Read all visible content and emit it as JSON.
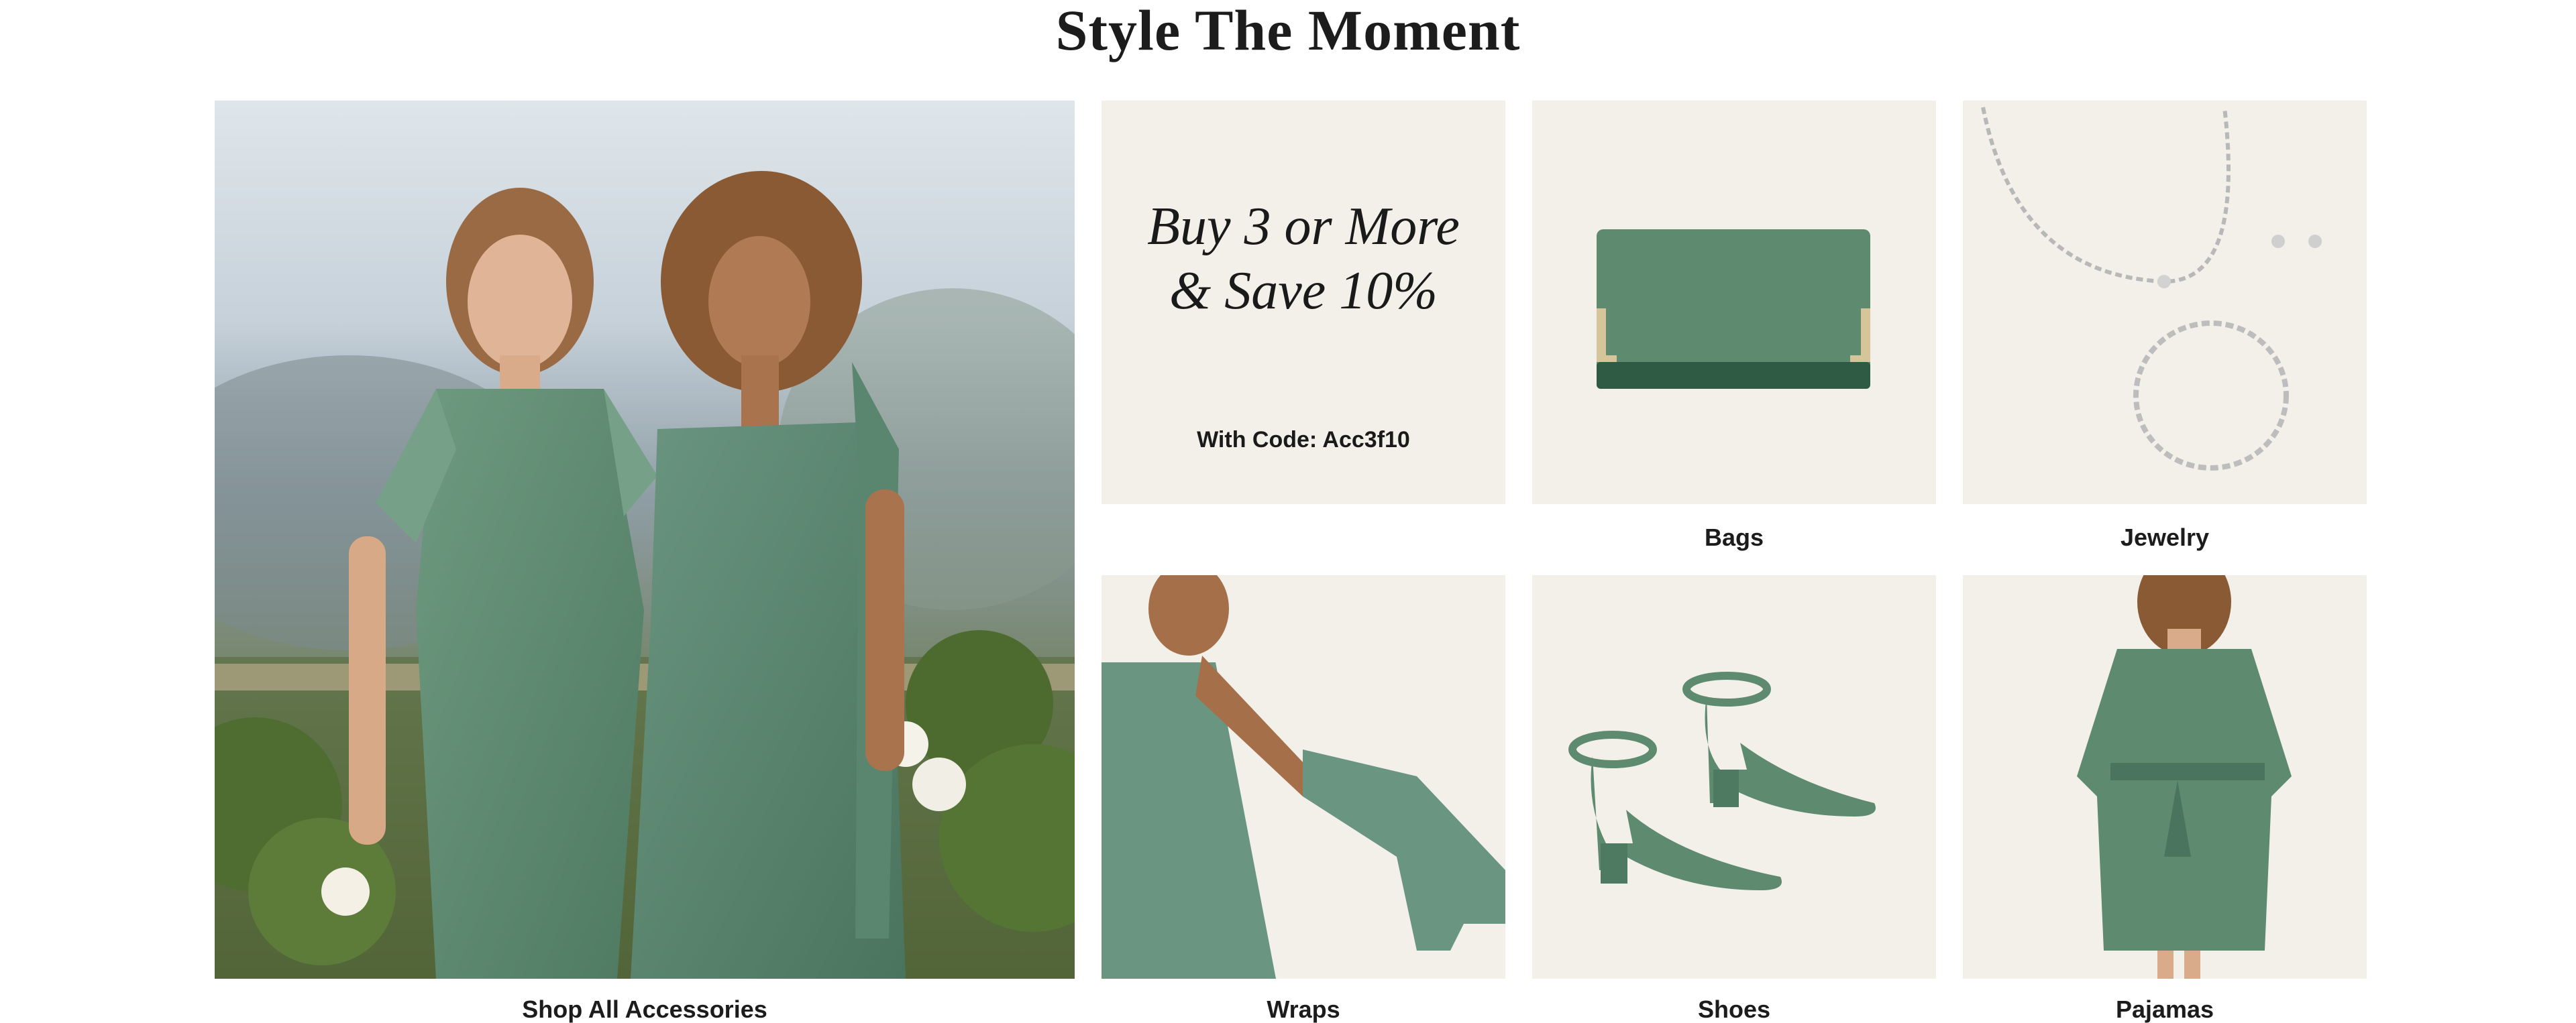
{
  "section": {
    "title": "Style The Moment"
  },
  "hero": {
    "label": "Shop All Accessories"
  },
  "promo": {
    "headline_line1": "Buy 3 or More",
    "headline_line2": "& Save 10%",
    "code_text": "With Code: Acc3f10"
  },
  "categories": [
    {
      "label": "Bags",
      "icon": "clutch-bag-image"
    },
    {
      "label": "Jewelry",
      "icon": "jewelry-set-image"
    },
    {
      "label": "Wraps",
      "icon": "chiffon-wrap-image"
    },
    {
      "label": "Shoes",
      "icon": "block-heel-sandals-image"
    },
    {
      "label": "Pajamas",
      "icon": "satin-robe-image"
    }
  ],
  "colors": {
    "sage_green": "#5e8a70",
    "tile_background": "#f3f0ea",
    "text": "#1c1c1c"
  }
}
